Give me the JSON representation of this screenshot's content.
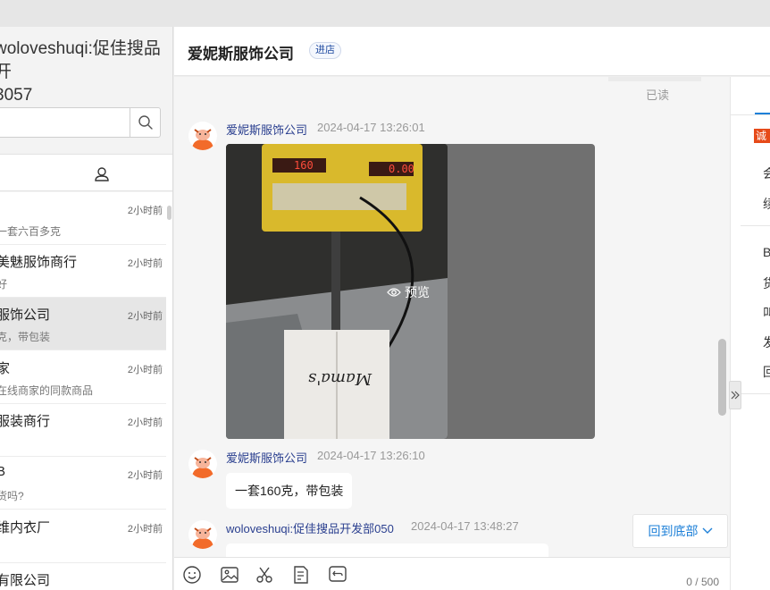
{
  "sidebar": {
    "title_line1": "woloveshuqi:促佳搜品开",
    "title_line2": "3057",
    "search": {
      "placeholder": ""
    },
    "tab_left_label": "'",
    "conversations": [
      {
        "name": "",
        "time": "2小时前",
        "preview": "一套六百多克"
      },
      {
        "name": "美魅服饰商行",
        "time": "2小时前",
        "preview": "好"
      },
      {
        "name": "服饰公司",
        "time": "2小时前",
        "preview": "克，带包装"
      },
      {
        "name": "家",
        "time": "2小时前",
        "preview": "在线商家的同款商品"
      },
      {
        "name": "服装商行",
        "time": "2小时前",
        "preview": ""
      },
      {
        "name": "B",
        "time": "2小时前",
        "preview": "货吗?"
      },
      {
        "name": "维内衣厂",
        "time": "2小时前",
        "preview": ""
      },
      {
        "name": "有限公司",
        "time": "",
        "preview": ""
      }
    ]
  },
  "chat": {
    "shop_name": "爱妮斯服饰公司",
    "shop_badge": "进店",
    "read_status": "已读",
    "messages": [
      {
        "sender": "爱妮斯服饰公司",
        "time": "2024-04-17 13:26:01",
        "preview_label": "预览"
      },
      {
        "sender": "爱妮斯服饰公司",
        "time": "2024-04-17 13:26:10",
        "text": "一套160克，带包装"
      },
      {
        "sender": "woloveshuqi:促佳搜品开发部050",
        "time": "2024-04-17 13:48:27"
      }
    ],
    "scale_display_left": "160",
    "scale_display_right": "0.00",
    "bag_print": "Mama's",
    "to_bottom_label": "回到底部",
    "counter": "0 / 500"
  },
  "right_panel": {
    "badge": "诚",
    "items_top": [
      "会",
      "续"
    ],
    "items_bottom": [
      "B",
      "货",
      "叫",
      "发",
      "回"
    ]
  },
  "colors": {
    "accent_blue": "#1e80d8",
    "link_blue": "#2a3f8f",
    "badge_orange": "#e64a19"
  }
}
